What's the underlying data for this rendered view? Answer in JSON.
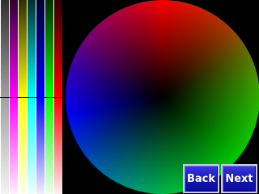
{
  "buttons": {
    "back_label": "Back",
    "next_label": "Next"
  },
  "color_bars": [
    {
      "name": "gray",
      "dark": "#303030",
      "mid": "#a0a0a0",
      "light": "#f4f4f4"
    },
    {
      "name": "magenta",
      "dark": "#300030",
      "mid": "#ff00ff",
      "light": "#fff0ff"
    },
    {
      "name": "yellow",
      "dark": "#303000",
      "mid": "#ffff00",
      "light": "#fffff0"
    },
    {
      "name": "cyan",
      "dark": "#003030",
      "mid": "#00ffff",
      "light": "#f0ffff"
    },
    {
      "name": "blue",
      "dark": "#000030",
      "mid": "#0000ff",
      "light": "#f0f0ff"
    },
    {
      "name": "green",
      "dark": "#003000",
      "mid": "#00ff00",
      "light": "#f0fff0"
    },
    {
      "name": "red",
      "dark": "#300000",
      "mid": "#ff0000",
      "light": "#fff0f0"
    }
  ],
  "colors": {
    "background": "#000000",
    "button_fill": "#1414b4",
    "button_border": "#c8c8e8",
    "button_text": "#ffffff"
  }
}
